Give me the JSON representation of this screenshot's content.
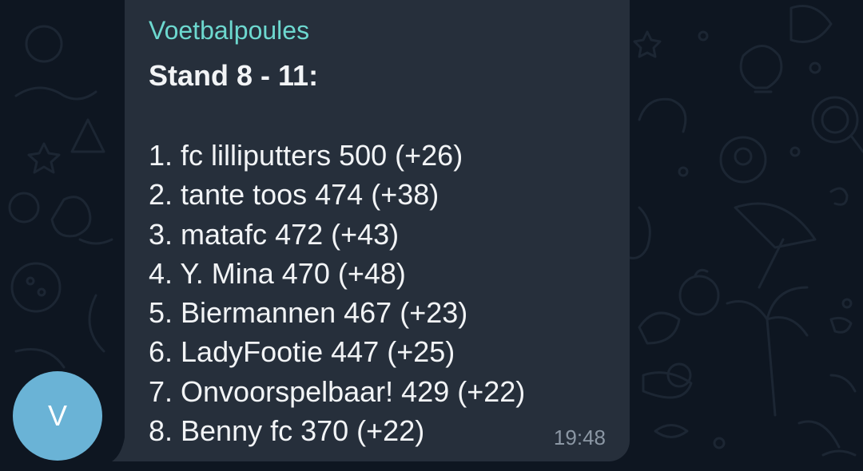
{
  "message": {
    "avatar_letter": "V",
    "sender": "Voetbalpoules",
    "title": "Stand 8 - 11:",
    "standings": [
      "1. fc lilliputters 500 (+26)",
      "2. tante toos 474 (+38)",
      "3. matafc 472 (+43)",
      "4. Y. Mina 470 (+48)",
      "5. Biermannen 467 (+23)",
      "6. LadyFootie 447 (+25)",
      "7. Onvoorspelbaar! 429 (+22)",
      "8. Benny fc 370 (+22)"
    ],
    "time": "19:48"
  },
  "colors": {
    "background": "#0e1621",
    "bubble": "#262f3b",
    "sender": "#6dd8cf",
    "avatar": "#6ab3d6",
    "text": "#f2f4f6",
    "time": "#8b97a4"
  }
}
